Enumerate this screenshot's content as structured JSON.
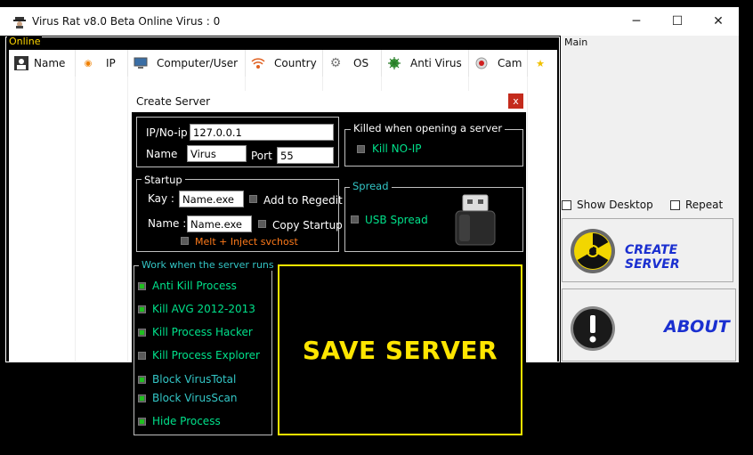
{
  "window": {
    "title": "Virus Rat v8.0 Beta Online Virus : 0",
    "minimize": "─",
    "maximize": "☐",
    "close": "✕"
  },
  "online": {
    "legend": "Online",
    "columns": [
      {
        "label": "Name",
        "icon": "user-icon"
      },
      {
        "label": "IP",
        "icon": "rss-icon"
      },
      {
        "label": "Computer/User",
        "icon": "computer-icon"
      },
      {
        "label": "Country",
        "icon": "signal-icon"
      },
      {
        "label": "OS",
        "icon": "gear-icon"
      },
      {
        "label": "Anti Virus",
        "icon": "virus-icon"
      },
      {
        "label": "Cam",
        "icon": "webcam-icon"
      },
      {
        "label": "",
        "icon": "star-icon"
      }
    ]
  },
  "main": {
    "legend": "Main",
    "show_desktop": "Show Desktop",
    "repeat": "Repeat",
    "create_server": "CREATE SERVER",
    "about": "ABOUT"
  },
  "dialog": {
    "title": "Create Server",
    "close": "x",
    "ip_label": "IP/No-ip",
    "ip_value": "127.0.0.1",
    "name_label": "Name",
    "name_value": "Virus",
    "port_label": "Port",
    "port_value": "55",
    "killed_legend": "Killed when opening a server",
    "kill_noip": "Kill NO-IP",
    "startup_legend": "Startup",
    "key_label": "Kay :",
    "key_value": "Name.exe",
    "add_regedit": "Add to Regedit",
    "startup_name_label": "Name :",
    "startup_name_value": "Name.exe",
    "copy_startup": "Copy Startup",
    "melt_inject": "Melt + Inject svchost",
    "spread_legend": "Spread",
    "usb_spread": "USB Spread",
    "work_legend": "Work when the server runs",
    "options": [
      {
        "label": "Anti Kill Process",
        "checked": true
      },
      {
        "label": "Kill AVG 2012-2013",
        "checked": true
      },
      {
        "label": "Kill Process Hacker",
        "checked": true
      },
      {
        "label": "Kill Process Explorer",
        "checked": false
      },
      {
        "label": "Block VirusTotal",
        "checked": true
      },
      {
        "label": "Block VirusScan",
        "checked": true
      },
      {
        "label": "Hide Process",
        "checked": true
      }
    ],
    "save": "SAVE SERVER"
  }
}
